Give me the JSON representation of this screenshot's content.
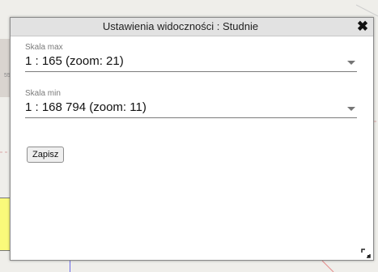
{
  "map": {
    "edge_label": "55"
  },
  "dialog": {
    "title": "Ustawienia widoczności : Studnie",
    "close_glyph": "✖"
  },
  "fields": {
    "max": {
      "label": "Skala max",
      "value": "1 : 165 (zoom: 21)"
    },
    "min": {
      "label": "Skala min",
      "value": "1 : 168 794 (zoom: 11)"
    }
  },
  "actions": {
    "save_label": "Zapisz"
  },
  "icons": {
    "close": "close-icon",
    "dropdown": "chevron-down-icon",
    "resize": "resize-handle-icon"
  }
}
